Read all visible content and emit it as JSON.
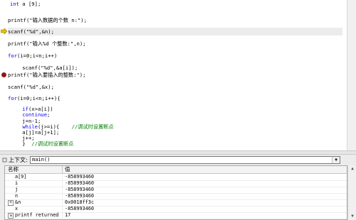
{
  "code": {
    "lines": [
      {
        "indent": "    ",
        "kw": "int",
        "rest": " a [9];"
      },
      {
        "text": "printf(\"输入数据的个数 n:\");"
      },
      {
        "text": "scanf(\"%d\",&n);"
      },
      {
        "text": "printf(\"输入%d 个整数:\",n);"
      },
      {
        "text": "for(i=0;i<n;i++)"
      },
      {
        "text": "    scanf(\"%d\",&a[i]);"
      },
      {
        "text": "printf(\"输入要插入的整数:\");"
      },
      {
        "text": "scanf(\"%d\",&x);"
      },
      {
        "text": "for(i=0;i<n;i++){"
      },
      {
        "text": "    if(x>a[i])"
      },
      {
        "text": "    continue;"
      },
      {
        "text": "    j=n-1;"
      },
      {
        "text": "    while(j>=i){",
        "comment": "//调试时设置断点"
      },
      {
        "text": "    a[j]=a[j+1];"
      },
      {
        "text": "    j++;"
      },
      {
        "text": "    }",
        "comment": "//调试时设置断点"
      }
    ]
  },
  "context": {
    "label": "上下文:",
    "value": "main()"
  },
  "watch": {
    "col_name": "名称",
    "col_value": "值",
    "rows": [
      {
        "name": "a[9]",
        "value": "-858993460",
        "expander": ""
      },
      {
        "name": "i",
        "value": "-858993460",
        "expander": ""
      },
      {
        "name": "j",
        "value": "-858993460",
        "expander": ""
      },
      {
        "name": "n",
        "value": "-858993460",
        "expander": ""
      },
      {
        "name": "&n",
        "value": "0x0018ff3c",
        "expander": "+"
      },
      {
        "name": "x",
        "value": "-858993460",
        "expander": ""
      },
      {
        "name": "printf returned",
        "value": "17",
        "expander": "⇲"
      }
    ]
  },
  "colors": {
    "keyword": "#0000ff",
    "comment": "#008000",
    "breakpoint": "#8b1a1a",
    "arrow": "#e6c200"
  }
}
